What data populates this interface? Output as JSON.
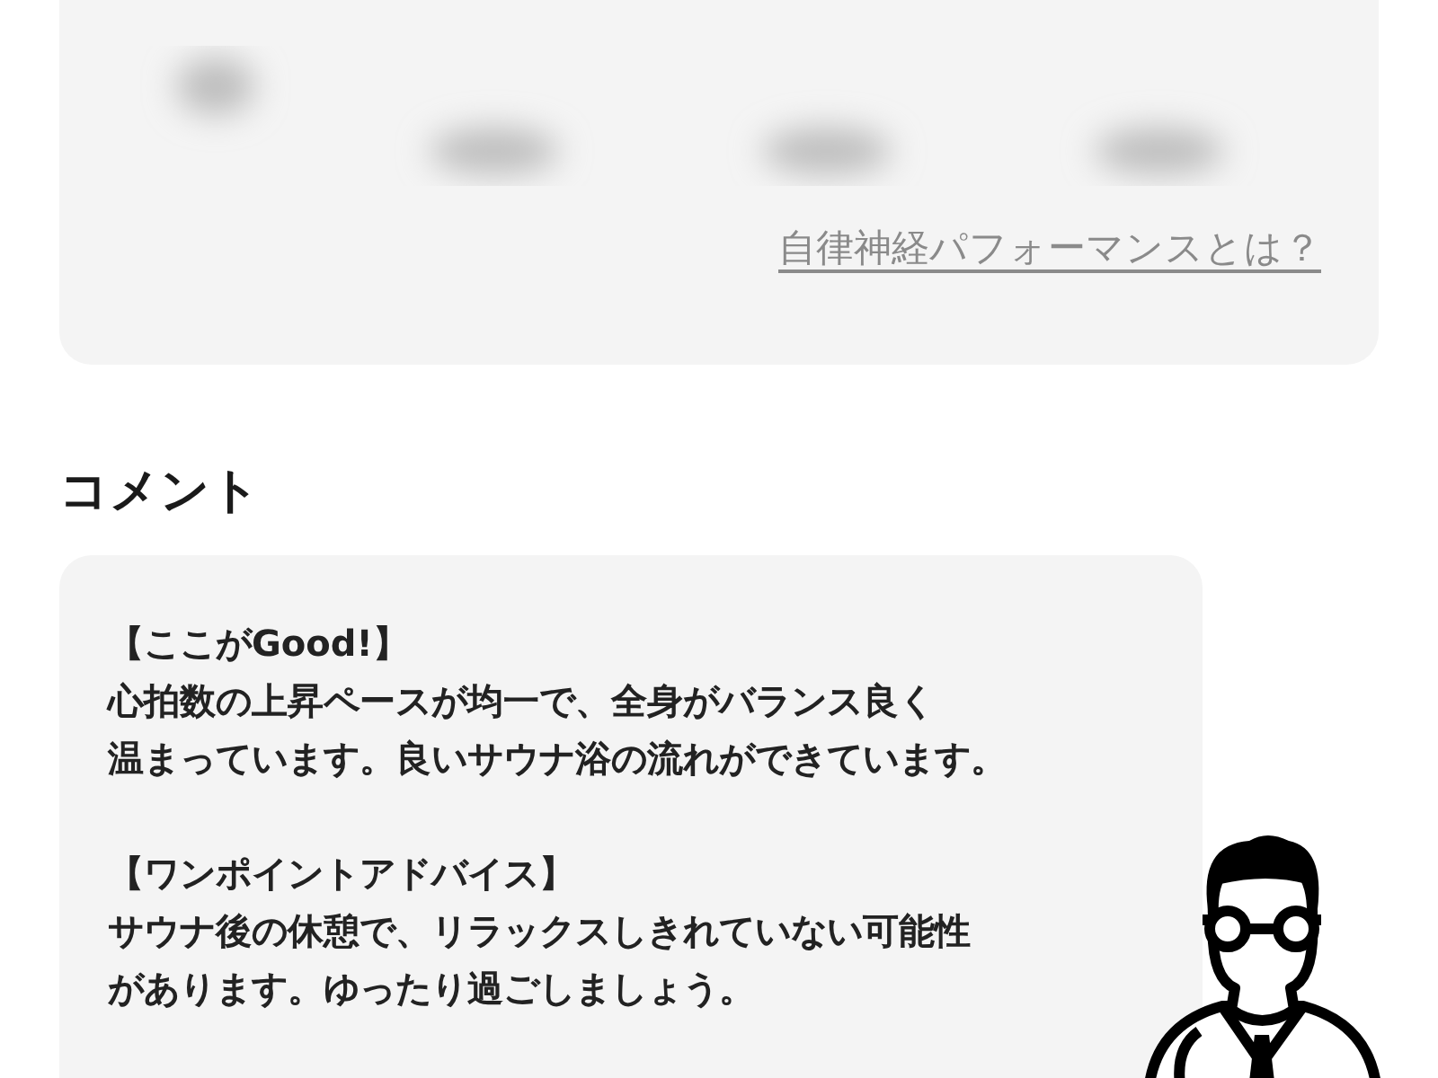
{
  "performance_card": {
    "link": "自律神経パフォーマンスとは？"
  },
  "comment": {
    "heading": "コメント",
    "sections": [
      {
        "heading": "【ここがGood!】",
        "lines": [
          "心拍数の上昇ペースが均一で、全身がバランス良く",
          "温まっています。良いサウナ浴の流れができています。"
        ]
      },
      {
        "heading": "【ワンポイントアドバイス】",
        "lines": [
          "サウナ後の休憩で、リラックスしきれていない可能性",
          "があります。ゆったり過ごしましょう。"
        ]
      }
    ]
  }
}
